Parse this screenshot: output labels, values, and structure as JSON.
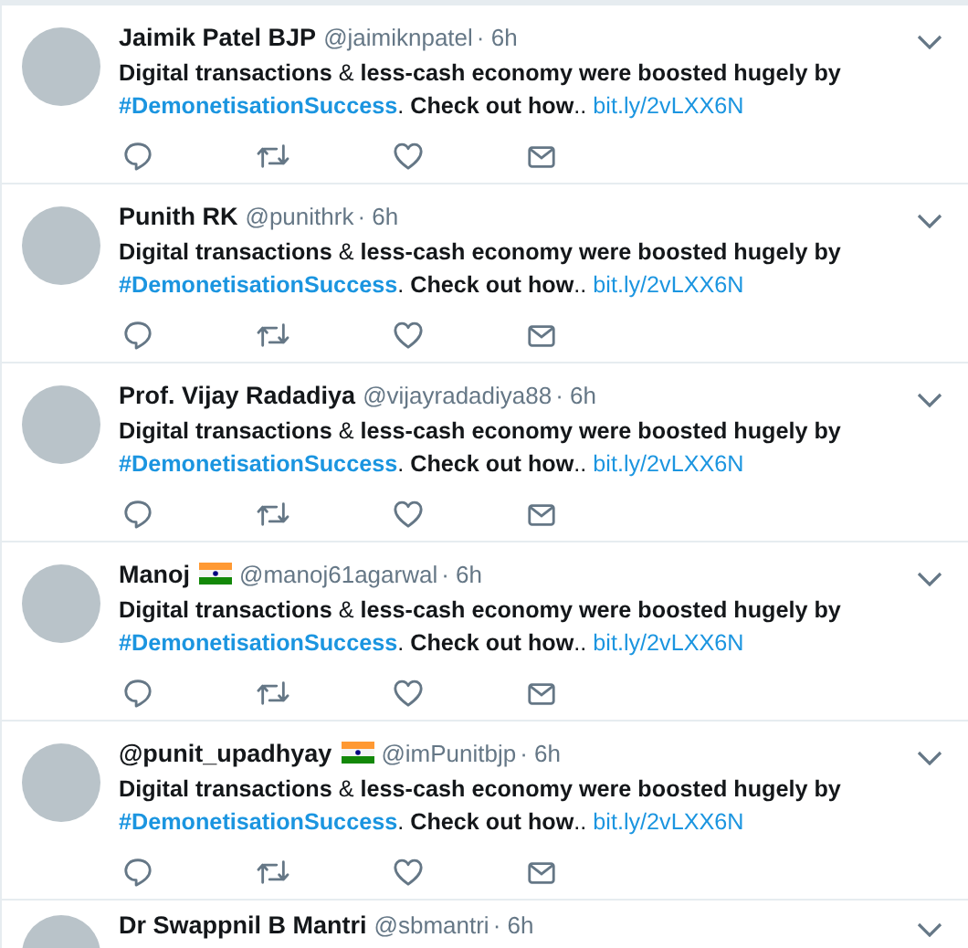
{
  "tweets": [
    {
      "name": "Jaimik Patel BJP",
      "flag": false,
      "handle": "@jaimiknpatel",
      "time": "· 6h",
      "text": "**Digital transactions** & **less-cash economy were boosted hugely by**",
      "hashtag": "#DemonetisationSuccess",
      "text_after": ". **Check out how**..",
      "link": "bit.ly/2vLXX6N"
    },
    {
      "name": "Punith RK",
      "flag": false,
      "handle": "@punithrk",
      "time": "· 6h",
      "text": "**Digital transactions** & **less-cash economy were boosted hugely by**",
      "hashtag": "#DemonetisationSuccess",
      "text_after": ". **Check out how**..",
      "link": "bit.ly/2vLXX6N"
    },
    {
      "name": "Prof. Vijay Radadiya",
      "flag": false,
      "handle": "@vijayradadiya88",
      "time": "· 6h",
      "text": "**Digital transactions** & **less-cash economy were boosted hugely by**",
      "hashtag": "#DemonetisationSuccess",
      "text_after": ". **Check out how**..",
      "link": "bit.ly/2vLXX6N"
    },
    {
      "name": "Manoj",
      "flag": true,
      "handle": "@manoj61agarwal",
      "time": "· 6h",
      "text": "**Digital transactions** & **less-cash economy were boosted hugely by**",
      "hashtag": "#DemonetisationSuccess",
      "text_after": ". **Check out how**..",
      "link": "bit.ly/2vLXX6N"
    },
    {
      "name": "@punit_upadhyay",
      "flag": true,
      "handle": "@imPunitbjp",
      "time": "· 6h",
      "text": "**Digital transactions** & **less-cash economy were boosted hugely by**",
      "hashtag": "#DemonetisationSuccess",
      "text_after": ". **Check out how**..",
      "link": "bit.ly/2vLXX6N"
    },
    {
      "name": "Dr Swappnil B Mantri",
      "flag": false,
      "handle": "@sbmantri",
      "time": "· 6h"
    }
  ]
}
